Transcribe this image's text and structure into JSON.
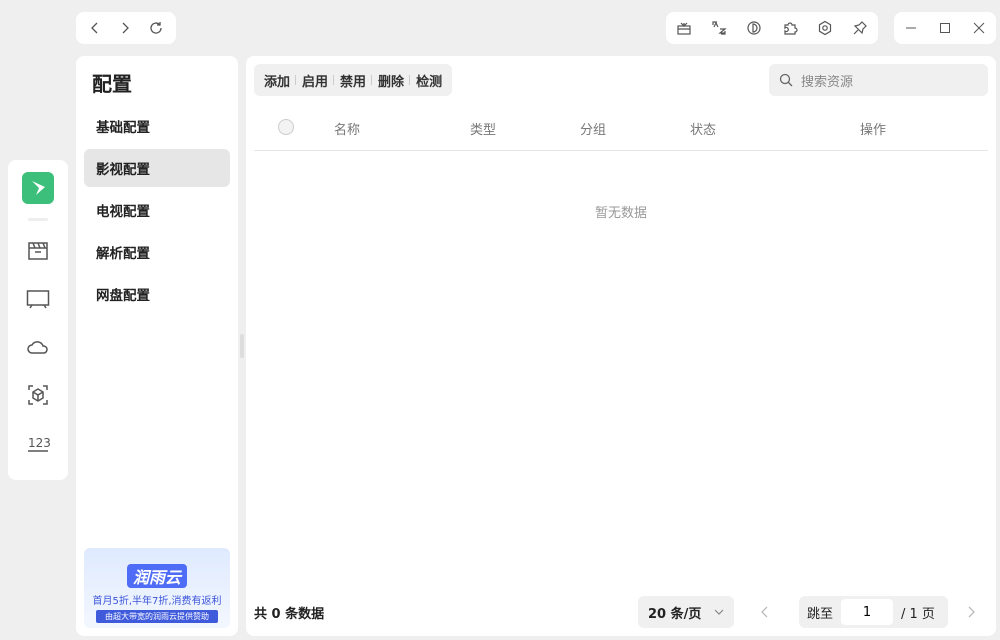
{
  "nav": {
    "back": "back",
    "forward": "forward",
    "refresh": "refresh"
  },
  "sidebar": {
    "title": "配置",
    "items": [
      {
        "label": "基础配置"
      },
      {
        "label": "影视配置"
      },
      {
        "label": "电视配置"
      },
      {
        "label": "解析配置"
      },
      {
        "label": "网盘配置"
      }
    ],
    "active": 1
  },
  "banner": {
    "brand": "润雨云",
    "line1": "首月5折,半年7折,消费有返利",
    "line2": "由超大带宽的润雨云提供赞助"
  },
  "toolbar": {
    "add": "添加",
    "enable": "启用",
    "disable": "禁用",
    "delete": "删除",
    "check": "检测"
  },
  "search": {
    "placeholder": "搜索资源"
  },
  "table": {
    "columns": [
      "名称",
      "类型",
      "分组",
      "状态",
      "操作"
    ],
    "empty": "暂无数据"
  },
  "footer": {
    "total": "共 0 条数据",
    "page_size": "20 条/页",
    "jump_label": "跳至",
    "page": "1",
    "page_total": "/ 1 页"
  },
  "colors": {
    "accent": "#3cbf7a"
  }
}
